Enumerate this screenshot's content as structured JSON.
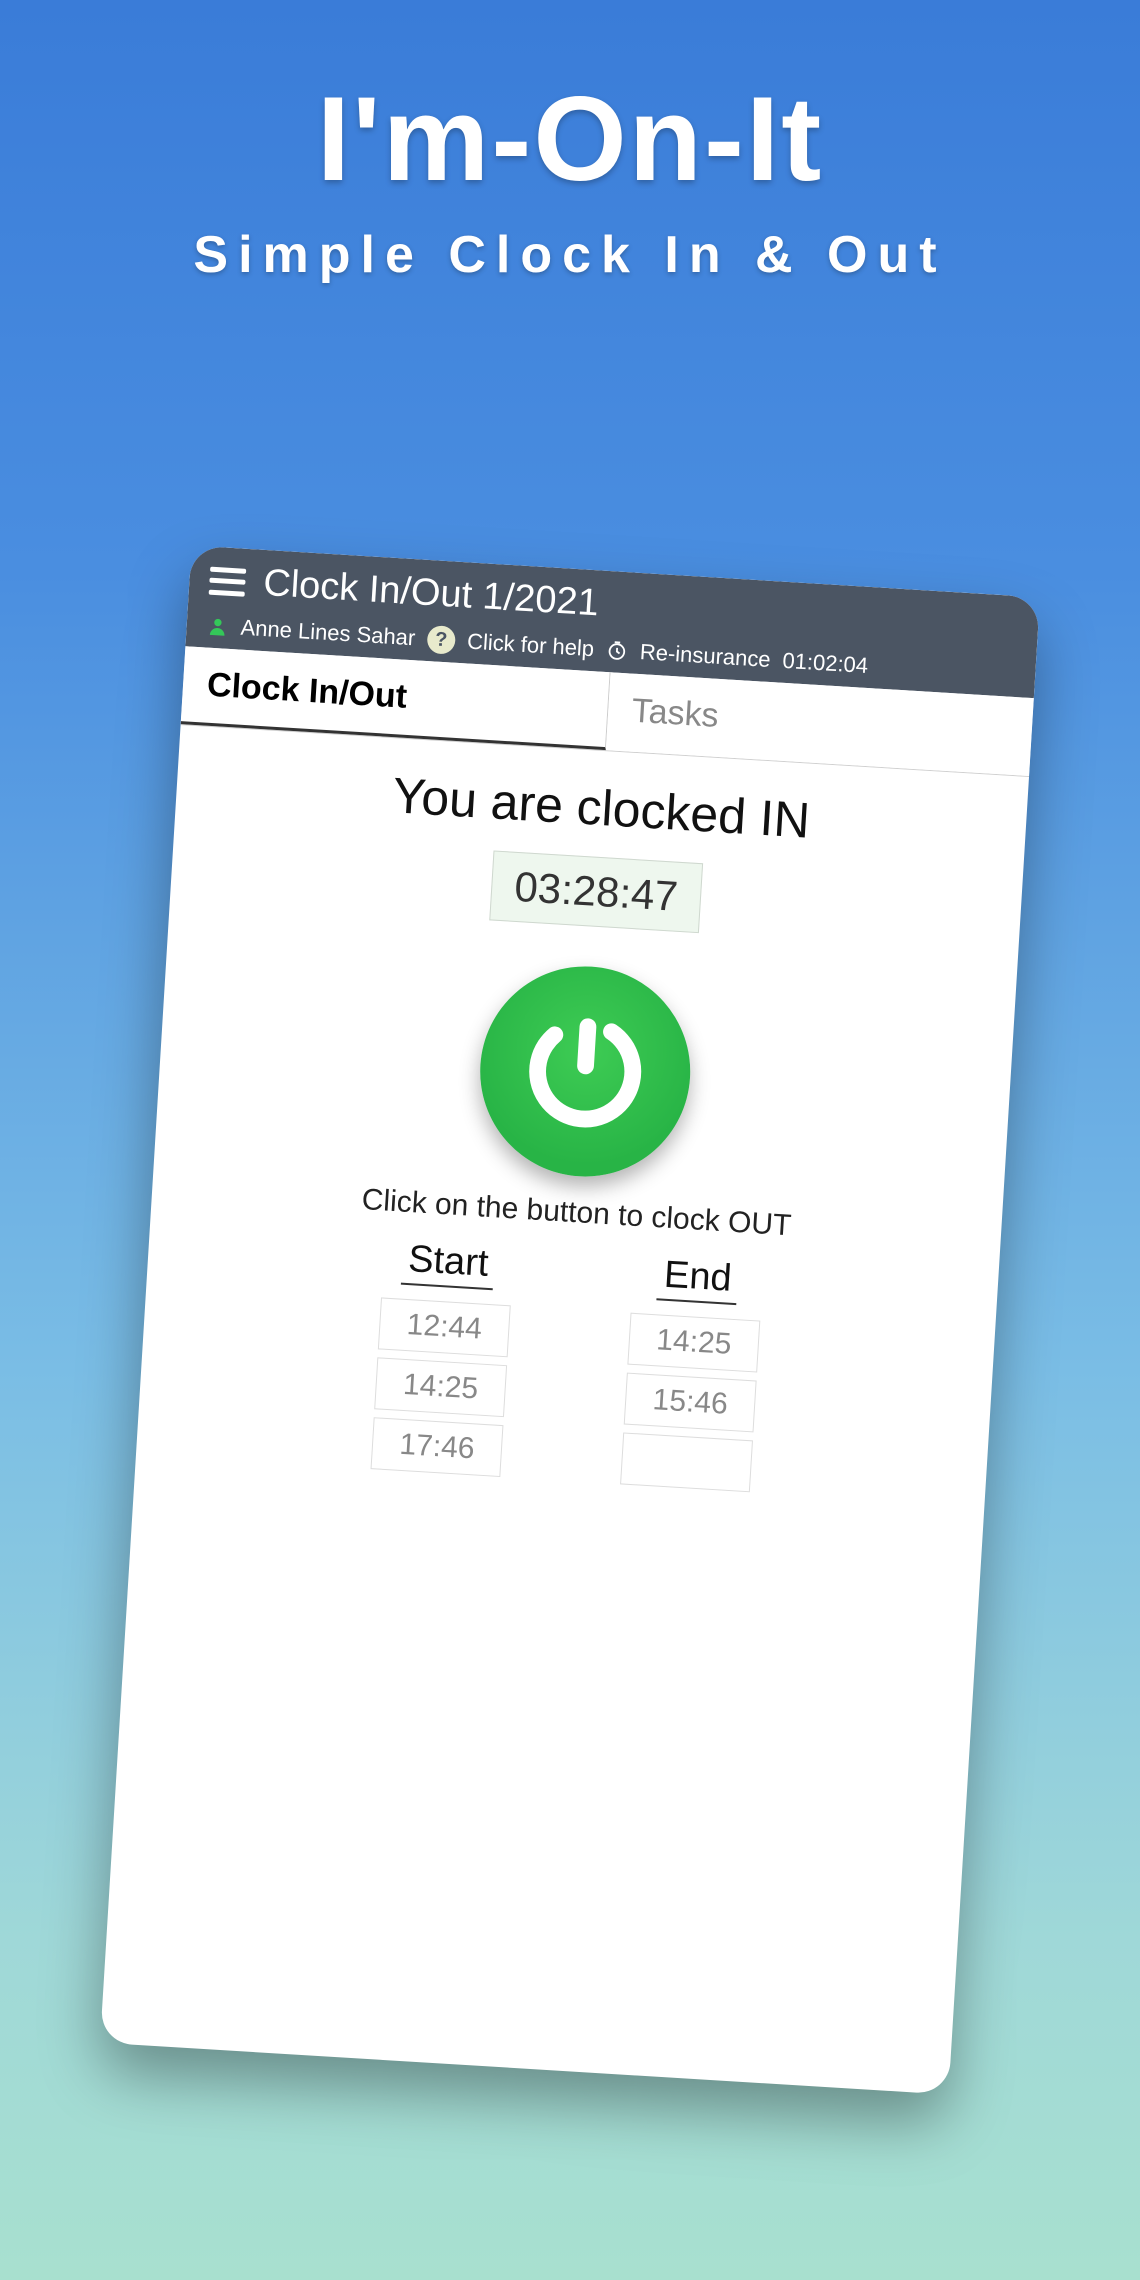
{
  "marketing": {
    "title": "I'm-On-It",
    "subtitle": "Simple Clock In & Out"
  },
  "header": {
    "title": "Clock In/Out 1/2021",
    "user_name": "Anne Lines Sahar",
    "help_label": "Click for help",
    "status_label": "Re-insurance",
    "status_time": "01:02:04"
  },
  "tabs": {
    "clock": "Clock In/Out",
    "tasks": "Tasks"
  },
  "main": {
    "status_text": "You are clocked IN",
    "elapsed": "03:28:47",
    "instruction": "Click on the button to clock OUT",
    "columns": {
      "start": "Start",
      "end": "End"
    },
    "entries": [
      {
        "start": "12:44",
        "end": "14:25"
      },
      {
        "start": "14:25",
        "end": "15:46"
      },
      {
        "start": "17:46",
        "end": ""
      }
    ]
  }
}
